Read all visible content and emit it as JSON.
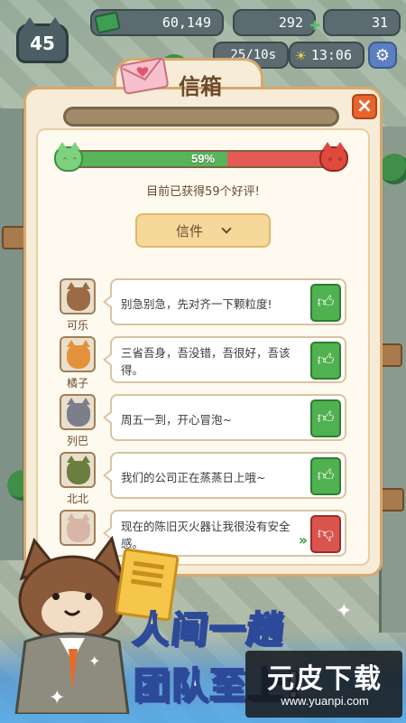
{
  "hud": {
    "level": "45",
    "money": "60,149",
    "hearts": "292",
    "gems": "31",
    "clock": "13:06",
    "timer": "25/10s"
  },
  "mailbox": {
    "title": "信箱",
    "rating_percent_label": "59%",
    "rating_fraction": 0.59,
    "praise_summary": "目前已获得59个好评!",
    "filter_label": "信件",
    "close_label": "×"
  },
  "letters": [
    {
      "name": "可乐",
      "text": "别急别急，先对齐一下颗粒度!",
      "vote": "up",
      "avatar_color": "#9b6b45"
    },
    {
      "name": "橘子",
      "text": "三省吾身，吾没错，吾很好，吾该得。",
      "vote": "up",
      "avatar_color": "#e4923a"
    },
    {
      "name": "列巴",
      "text": "周五一到，开心冒泡~",
      "vote": "up",
      "avatar_color": "#7a7f8a"
    },
    {
      "name": "北北",
      "text": "我们的公司正在蒸蒸日上哦~",
      "vote": "up",
      "avatar_color": "#6b7e3e"
    },
    {
      "name": "",
      "text": "现在的陈旧灭火器让我很没有安全感。",
      "vote": "down",
      "avatar_color": "#d8b6a6"
    }
  ],
  "promo": {
    "line1": "人间一趟",
    "line2": "团队至上!"
  },
  "watermark": {
    "title": "元皮下载",
    "url": "www.yuanpi.com"
  },
  "colors": {
    "panel": "#f7ecd7",
    "border": "#d7a86e",
    "like": "#4fb14f",
    "dislike": "#d9544d",
    "close": "#e8642d"
  }
}
